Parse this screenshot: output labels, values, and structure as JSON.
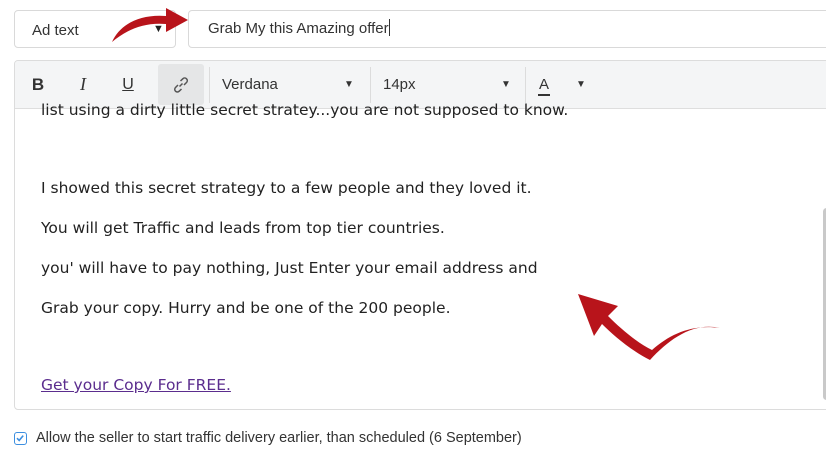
{
  "ad_type": {
    "label": "Ad text"
  },
  "subject": {
    "value": "Grab My this Amazing offer"
  },
  "toolbar": {
    "bold": "B",
    "italic": "I",
    "underline": "U",
    "font_family": "Verdana",
    "font_size": "14px",
    "color_label": "A"
  },
  "content": {
    "lines": [
      "list using a dirty little secret stratey...you are not supposed to know.",
      "I showed this secret strategy to a few people and they loved it.",
      "You will get Traffic and leads from top tier countries.",
      "you' will have to pay nothing, Just Enter your email address and",
      "Grab your copy. Hurry and be one of the 200 people."
    ],
    "link_text": "Get your Copy For FREE."
  },
  "option": {
    "checked": true,
    "label": "Allow the seller to start traffic delivery earlier, than scheduled (6 September)"
  },
  "colors": {
    "arrow": "#b8141b",
    "link": "#5b2d8e",
    "checkbox": "#3d8fe0"
  }
}
